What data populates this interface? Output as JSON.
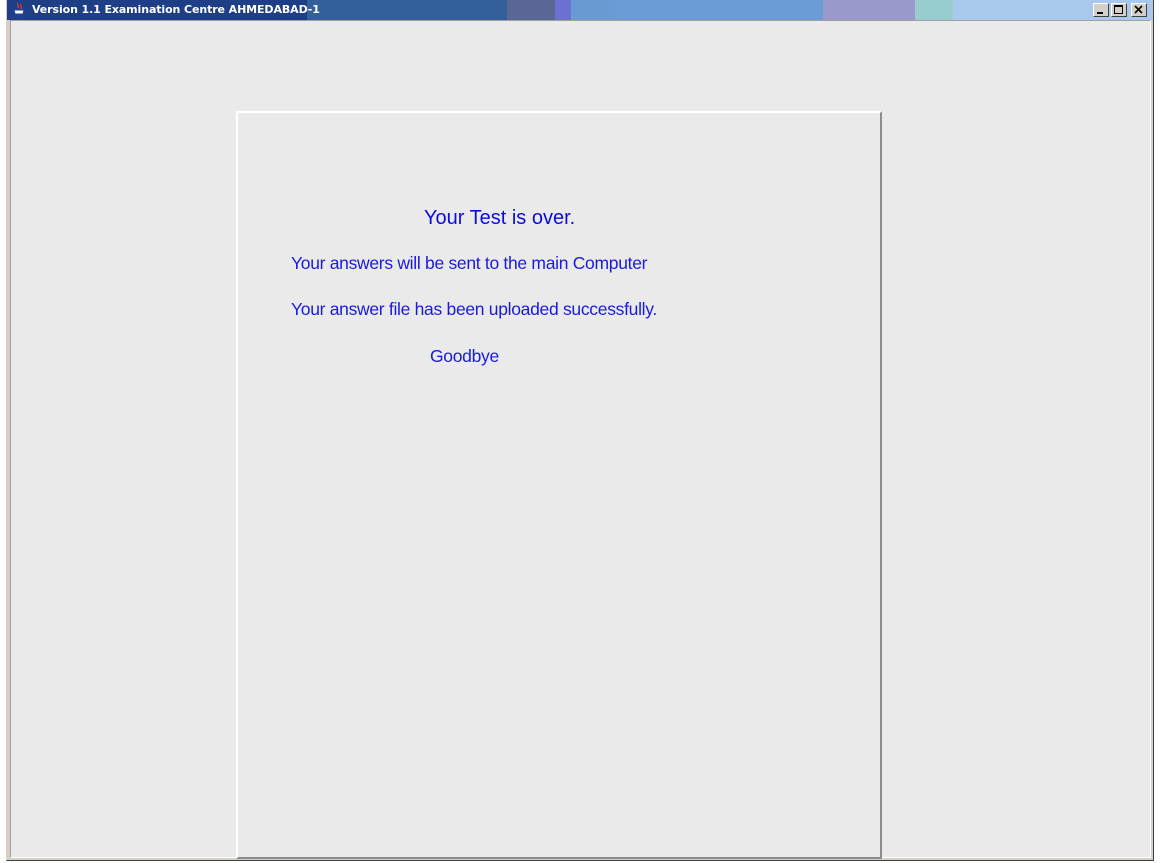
{
  "window": {
    "title": "Version 1.1 Examination Centre AHMEDABAD-1",
    "app_icon": "java-coffee-cup-icon",
    "controls": [
      "minimize-icon",
      "maximize-icon",
      "close-icon"
    ]
  },
  "message": {
    "title": "Your Test is over.",
    "line1": "Your answers will be  sent to the main Computer",
    "line2": "Your answer file has been uploaded successfully.",
    "line3": "Goodbye"
  },
  "colors": {
    "message_text": "#1a1ae0",
    "background": "#eaeaea"
  }
}
